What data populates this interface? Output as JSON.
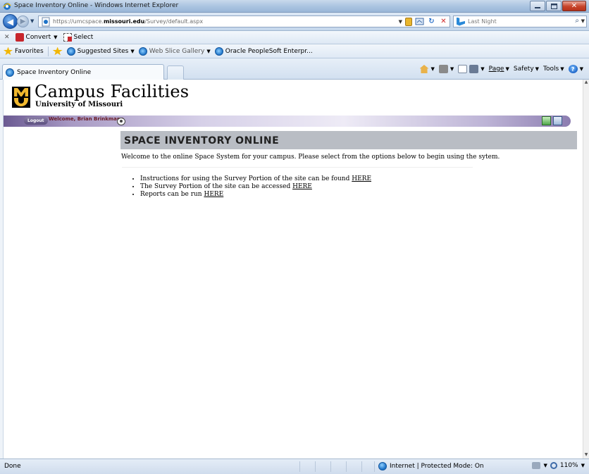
{
  "window": {
    "title": "Space Inventory Online - Windows Internet Explorer"
  },
  "address_bar": {
    "url_prefix": "https://umcspace.",
    "url_domain": "missouri.edu",
    "url_path": "/Survey/default.aspx",
    "search_placeholder": "Last Night"
  },
  "convert_bar": {
    "convert_label": "Convert",
    "select_label": "Select"
  },
  "favorites_bar": {
    "favorites_label": "Favorites",
    "items": [
      {
        "label": "Suggested Sites",
        "has_dropdown": true
      },
      {
        "label": "Web Slice Gallery",
        "has_dropdown": true
      },
      {
        "label": "Oracle PeopleSoft Enterpr...",
        "has_dropdown": false
      }
    ]
  },
  "tab_bar": {
    "active_tab": "Space Inventory Online",
    "commands": {
      "page": "Page",
      "safety": "Safety",
      "tools": "Tools"
    }
  },
  "page": {
    "brand_title": "Campus Facilities",
    "brand_subtitle": "University of Missouri",
    "logout_label": "Logout",
    "welcome_text": "Welcome, Brian Brinkmann",
    "heading": "SPACE INVENTORY ONLINE",
    "intro": "Welcome to the online Space System for your campus. Please select from the options below to begin using the sytem.",
    "options": [
      {
        "text": "Instructions for using the Survey Portion of the site can be found",
        "link": "HERE"
      },
      {
        "text": "The Survey Portion of the site can be accessed",
        "link": "HERE"
      },
      {
        "text": "Reports can be run",
        "link": "HERE"
      }
    ]
  },
  "status_bar": {
    "status": "Done",
    "zone": "Internet | Protected Mode: On",
    "zoom": "110%"
  },
  "colors": {
    "brand_gold": "#f1b82d",
    "banner_gray": "#b9bdc4",
    "welcome_text": "#6a1b28"
  }
}
